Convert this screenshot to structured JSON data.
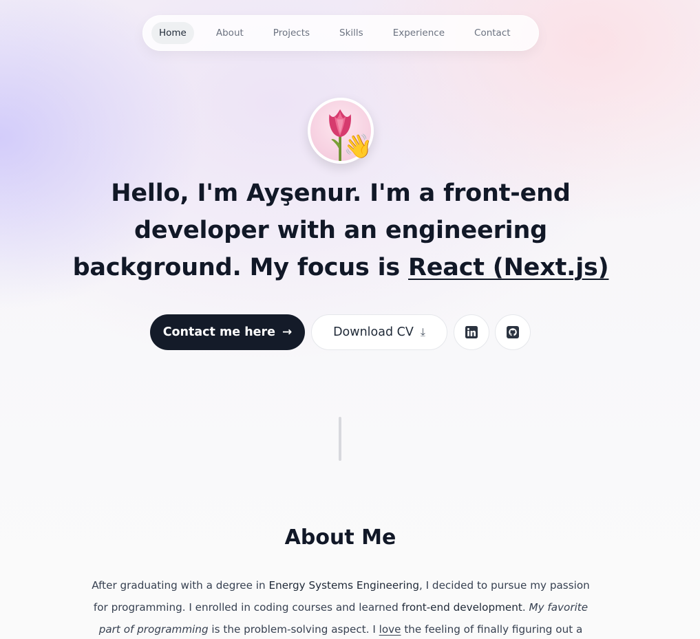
{
  "nav": {
    "items": [
      {
        "label": "Home",
        "active": true
      },
      {
        "label": "About",
        "active": false
      },
      {
        "label": "Projects",
        "active": false
      },
      {
        "label": "Skills",
        "active": false
      },
      {
        "label": "Experience",
        "active": false
      },
      {
        "label": "Contact",
        "active": false
      }
    ]
  },
  "hero": {
    "avatar_icon": "tulip-icon",
    "wave_emoji": "👋",
    "headline": {
      "p1": "Hello, I'm Ayşenur",
      "p2": ". I'm a ",
      "p3": "front-end developer",
      "p4": " with an ",
      "p5": "engineering background",
      "p6": ". My focus is ",
      "p7": "React (Next.js)"
    },
    "contact_label": "Contact me here",
    "contact_arrow": "→",
    "download_label": "Download CV",
    "download_icon": "⤓",
    "linkedin_icon": "linkedin-icon",
    "github_icon": "github-icon"
  },
  "about": {
    "title": "About Me",
    "t1": "After graduating with a degree in ",
    "t2": "Energy Systems Engineering",
    "t3": ", I decided to pursue my passion for programming. I enrolled in coding courses and learned ",
    "t4": "front-end development",
    "t5": ". ",
    "t6": "My favorite part of programming",
    "t7": " is the problem-solving aspect. I ",
    "t8": "love",
    "t9": " the feeling of finally figuring out a"
  },
  "colors": {
    "primary_button": "#141b29",
    "text": "#111827",
    "muted": "#6b7280"
  }
}
